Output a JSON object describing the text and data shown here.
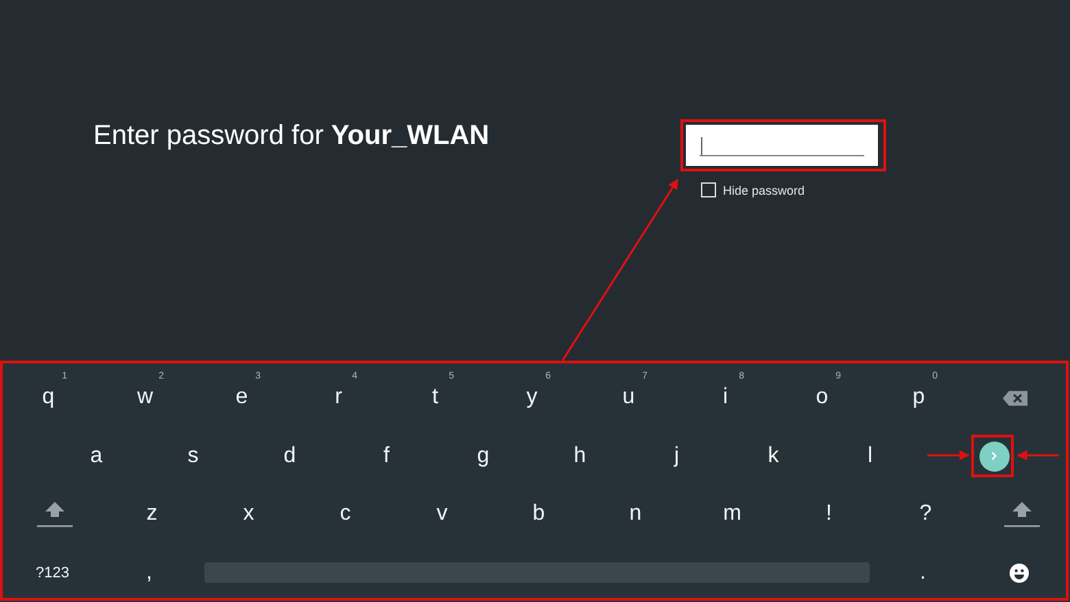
{
  "prompt": {
    "title": "Enter password for **Your_WLAN**"
  },
  "password_field": {
    "focused": true
  },
  "hide_password": {
    "label": "Hide password",
    "checked": false
  },
  "keyboard": {
    "rows": [
      [
        {
          "kind": "letter",
          "label": "q",
          "hint": "1"
        },
        {
          "kind": "letter",
          "label": "w",
          "hint": "2"
        },
        {
          "kind": "letter",
          "label": "e",
          "hint": "3"
        },
        {
          "kind": "letter",
          "label": "r",
          "hint": "4"
        },
        {
          "kind": "letter",
          "label": "t",
          "hint": "5"
        },
        {
          "kind": "letter",
          "label": "y",
          "hint": "6"
        },
        {
          "kind": "letter",
          "label": "u",
          "hint": "7"
        },
        {
          "kind": "letter",
          "label": "i",
          "hint": "8"
        },
        {
          "kind": "letter",
          "label": "o",
          "hint": "9"
        },
        {
          "kind": "letter",
          "label": "p",
          "hint": "0"
        },
        {
          "kind": "backspace"
        }
      ],
      [
        {
          "kind": "letter",
          "label": "a"
        },
        {
          "kind": "letter",
          "label": "s"
        },
        {
          "kind": "letter",
          "label": "d"
        },
        {
          "kind": "letter",
          "label": "f"
        },
        {
          "kind": "letter",
          "label": "g"
        },
        {
          "kind": "letter",
          "label": "h"
        },
        {
          "kind": "letter",
          "label": "j"
        },
        {
          "kind": "letter",
          "label": "k"
        },
        {
          "kind": "letter",
          "label": "l"
        },
        {
          "kind": "enter"
        }
      ],
      [
        {
          "kind": "shift"
        },
        {
          "kind": "letter",
          "label": "z"
        },
        {
          "kind": "letter",
          "label": "x"
        },
        {
          "kind": "letter",
          "label": "c"
        },
        {
          "kind": "letter",
          "label": "v"
        },
        {
          "kind": "letter",
          "label": "b"
        },
        {
          "kind": "letter",
          "label": "n"
        },
        {
          "kind": "letter",
          "label": "m"
        },
        {
          "kind": "letter",
          "label": "!"
        },
        {
          "kind": "letter",
          "label": "?"
        },
        {
          "kind": "shift"
        }
      ]
    ],
    "bottom_bar": {
      "symbols_key": "?123",
      "comma_key": ",",
      "period_key": "."
    }
  }
}
